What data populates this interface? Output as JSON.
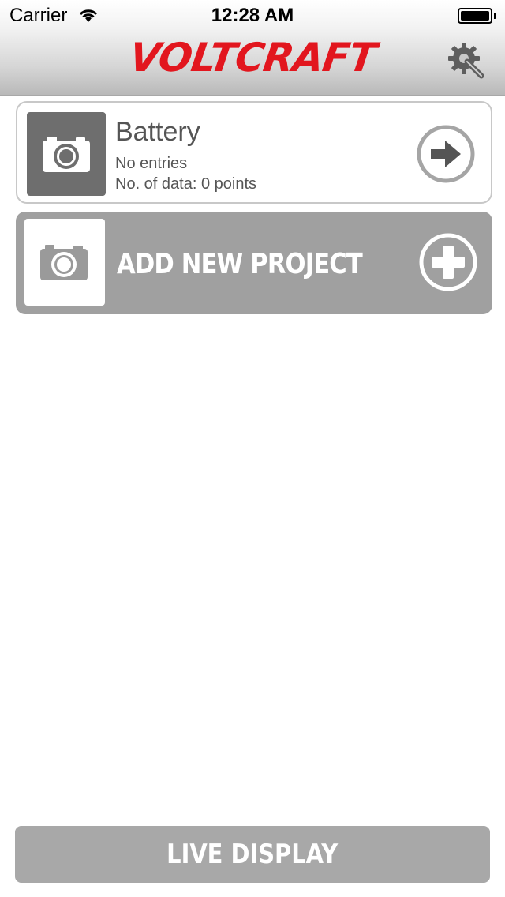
{
  "status_bar": {
    "carrier": "Carrier",
    "time": "12:28 AM"
  },
  "header": {
    "logo_text": "VOLTCRAFT",
    "logo_color": "#e2161e",
    "settings_icon": "gear-wrench-icon"
  },
  "projects": [
    {
      "title": "Battery",
      "entries": "No entries",
      "data_points": "No. of data: 0 points",
      "thumbnail_icon": "camera-icon",
      "action_icon": "arrow-right-circle-icon"
    }
  ],
  "add_project": {
    "label": "ADD NEW PROJECT",
    "thumbnail_icon": "camera-icon",
    "action_icon": "plus-circle-icon"
  },
  "footer": {
    "live_display_label": "LIVE DISPLAY"
  }
}
